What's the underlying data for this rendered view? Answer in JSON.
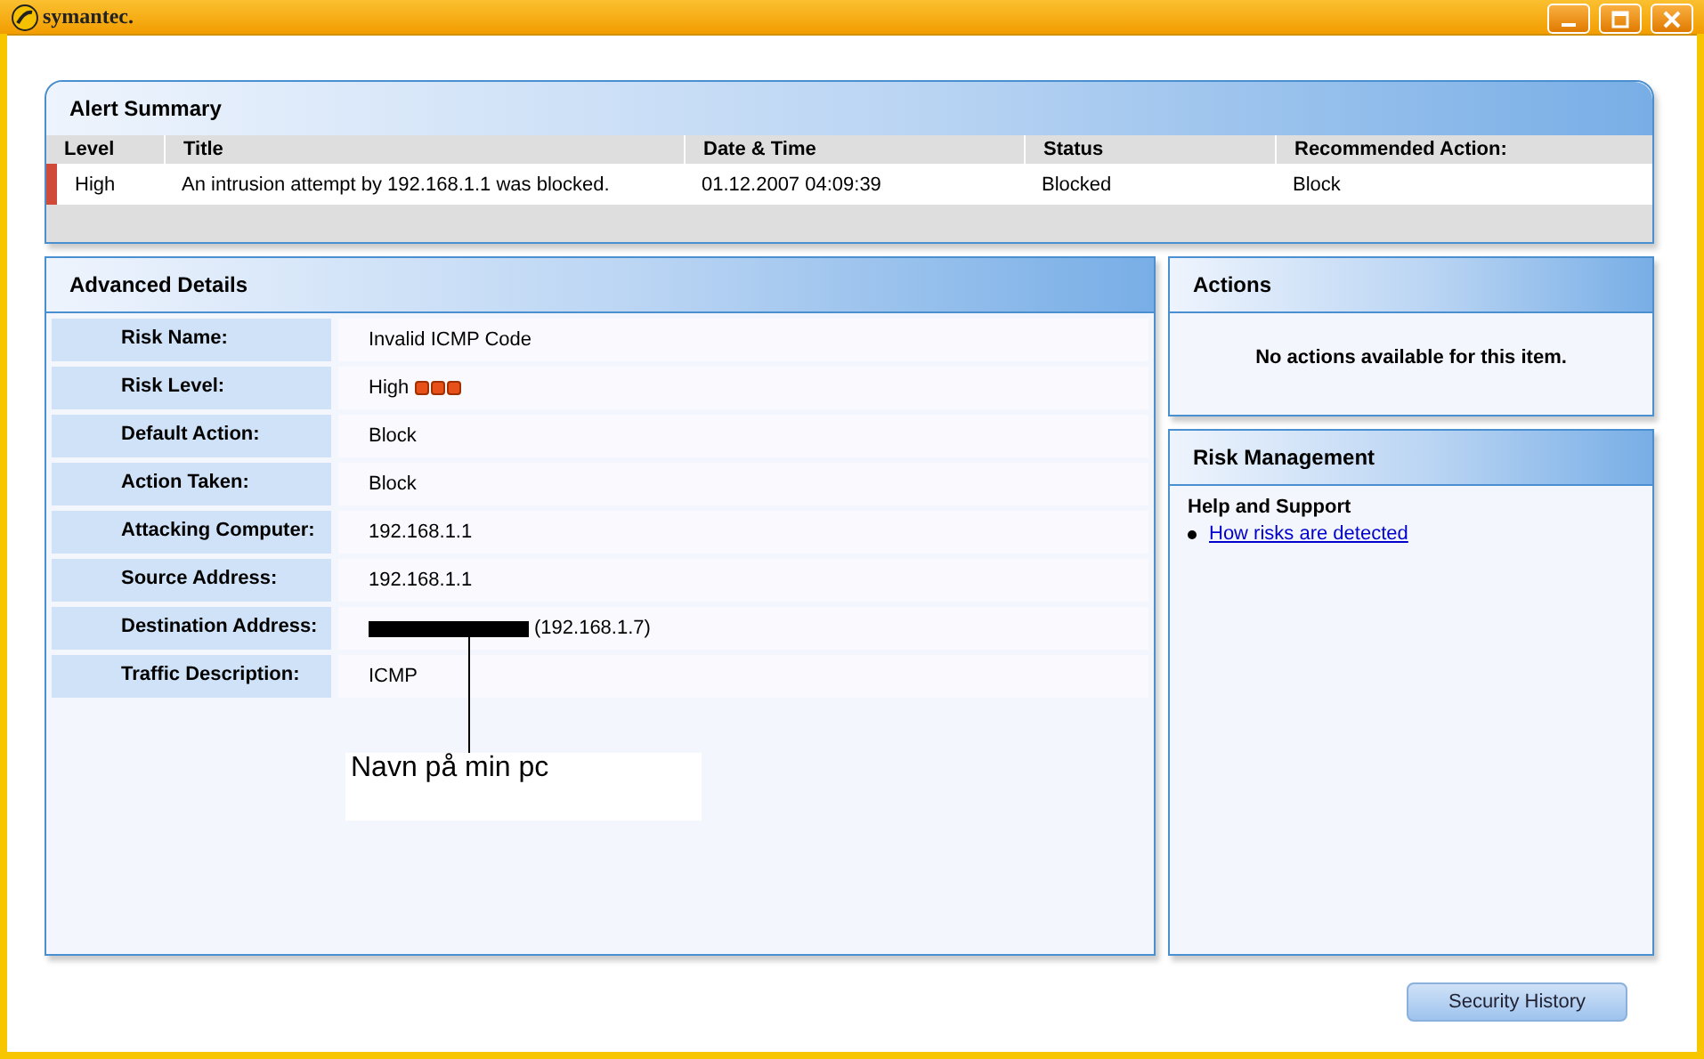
{
  "window": {
    "logo": "symantec."
  },
  "alert_summary": {
    "title": "Alert Summary",
    "columns": [
      "Level",
      "Title",
      "Date & Time",
      "Status",
      "Recommended Action:"
    ],
    "rows": [
      {
        "cells": [
          "High",
          "An intrusion attempt by 192.168.1.1 was blocked.",
          "01.12.2007 04:09:39",
          "Blocked",
          "Block"
        ]
      }
    ]
  },
  "advanced_details": {
    "title": "Advanced Details",
    "rows": [
      {
        "label": "Risk Name:",
        "value": "Invalid ICMP Code"
      },
      {
        "label": "Risk Level:",
        "value": "High",
        "stars": 3
      },
      {
        "label": "Default Action:",
        "value": "Block"
      },
      {
        "label": "Action Taken:",
        "value": "Block"
      },
      {
        "label": "Attacking Computer:",
        "value": "192.168.1.1"
      },
      {
        "label": "Source Address:",
        "value": "192.168.1.1"
      },
      {
        "label": "Destination Address:",
        "value": "(192.168.1.7)",
        "redacted": true
      },
      {
        "label": "Traffic Description:",
        "value": "ICMP"
      }
    ]
  },
  "annotation": {
    "text": "Navn på min pc"
  },
  "actions": {
    "title": "Actions",
    "message": "No actions available for this item."
  },
  "risk_management": {
    "title": "Risk Management",
    "heading": "Help and Support",
    "links": [
      "How risks are detected"
    ]
  },
  "button": "Security History"
}
